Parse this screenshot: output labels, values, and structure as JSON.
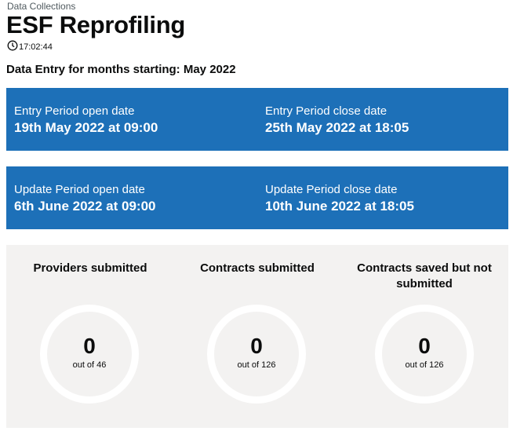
{
  "header": {
    "caption": "Data Collections",
    "title": "ESF Reprofiling",
    "time": "17:02:44"
  },
  "subheading": "Data Entry for months starting: May 2022",
  "entry_period": {
    "open_label": "Entry Period open date",
    "open_value": "19th May 2022 at 09:00",
    "close_label": "Entry Period close date",
    "close_value": "25th May 2022 at 18:05"
  },
  "update_period": {
    "open_label": "Update Period open date",
    "open_value": "6th June 2022 at 09:00",
    "close_label": "Update Period close date",
    "close_value": "10th June 2022 at 18:05"
  },
  "stats": [
    {
      "title": "Providers submitted",
      "value": "0",
      "total": "out of 46"
    },
    {
      "title": "Contracts submitted",
      "value": "0",
      "total": "out of 126"
    },
    {
      "title": "Contracts saved but not submitted",
      "value": "0",
      "total": "out of 126"
    }
  ],
  "colors": {
    "band": "#1d70b8",
    "stats_bg": "#f3f2f1",
    "ring": "#ffffff"
  }
}
